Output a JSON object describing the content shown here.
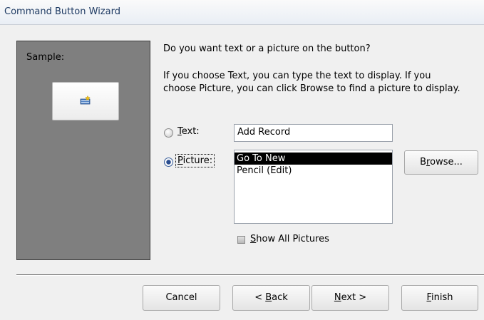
{
  "window": {
    "title": "Command Button Wizard"
  },
  "sample": {
    "label": "Sample:",
    "icon": "add-record-icon"
  },
  "prompt": {
    "question": "Do you want text or a picture on the button?",
    "help_line1": "If you choose Text, you can type the text to display.  If you",
    "help_line2": "choose Picture, you can click Browse to find a picture to display."
  },
  "options": {
    "text": {
      "label_first": "T",
      "label_rest": "ext:",
      "value": "Add Record",
      "selected": false
    },
    "picture": {
      "label_first": "P",
      "label_rest": "icture:",
      "selected": true
    }
  },
  "pictures": [
    {
      "label": "Go To New",
      "selected": true
    },
    {
      "label": "Pencil (Edit)",
      "selected": false
    }
  ],
  "browse": {
    "pre": "B",
    "accel": "r",
    "post": "owse..."
  },
  "show_all": {
    "accel": "S",
    "rest": "how All Pictures",
    "checked": false
  },
  "buttons": {
    "cancel": "Cancel",
    "back": {
      "pre": "< ",
      "accel": "B",
      "post": "ack"
    },
    "next": {
      "accel": "N",
      "post": "ext >"
    },
    "finish": {
      "accel": "F",
      "post": "inish"
    }
  }
}
